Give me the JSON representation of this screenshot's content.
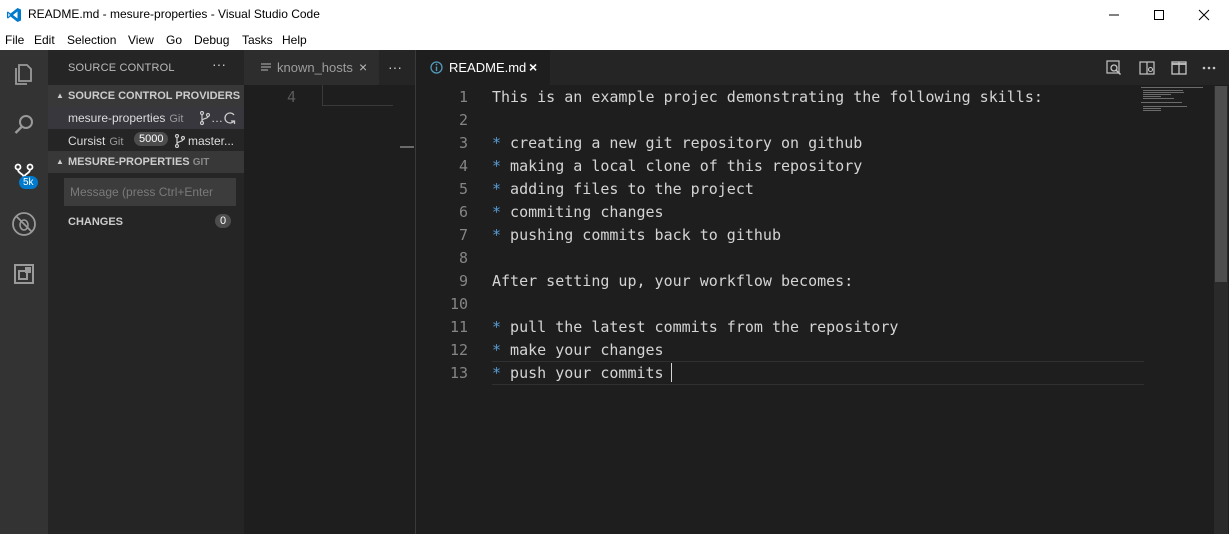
{
  "window": {
    "title": "README.md - mesure-properties - Visual Studio Code"
  },
  "menu": [
    "File",
    "Edit",
    "Selection",
    "View",
    "Go",
    "Debug",
    "Tasks",
    "Help"
  ],
  "activity_bar": {
    "items": [
      "explorer-icon",
      "search-icon",
      "source-control-icon",
      "debug-icon",
      "extensions-icon"
    ],
    "scm_badge": "5k"
  },
  "sidebar": {
    "title": "SOURCE CONTROL",
    "more": "···",
    "providers_header": "SOURCE CONTROL PROVIDERS",
    "providers": [
      {
        "name": "mesure-properties",
        "type": "Git",
        "extra": "…"
      },
      {
        "name": "Cursist",
        "type": "Git",
        "count": "5000",
        "branch": "master..."
      }
    ],
    "repo_header": "MESURE-PROPERTIES",
    "repo_header_type": "GIT",
    "message_placeholder": "Message (press Ctrl+Enter",
    "changes_label": "CHANGES",
    "changes_count": "0"
  },
  "editor_group1": {
    "tab_label": "known_hosts",
    "close": "×",
    "more": "···",
    "line_number": "4"
  },
  "editor_group2": {
    "tab_label": "README.md",
    "close": "×",
    "lines": [
      {
        "n": "1",
        "bullet": "",
        "text": "This is an example projec demonstrating the following skills:"
      },
      {
        "n": "2",
        "bullet": "",
        "text": ""
      },
      {
        "n": "3",
        "bullet": "*",
        "text": " creating a new git repository on github"
      },
      {
        "n": "4",
        "bullet": "*",
        "text": " making a local clone of this repository"
      },
      {
        "n": "5",
        "bullet": "*",
        "text": " adding files to the project"
      },
      {
        "n": "6",
        "bullet": "*",
        "text": " commiting changes"
      },
      {
        "n": "7",
        "bullet": "*",
        "text": " pushing commits back to github"
      },
      {
        "n": "8",
        "bullet": "",
        "text": ""
      },
      {
        "n": "9",
        "bullet": "",
        "text": "After setting up, your workflow becomes:"
      },
      {
        "n": "10",
        "bullet": "",
        "text": ""
      },
      {
        "n": "11",
        "bullet": "*",
        "text": " pull the latest commits from the repository"
      },
      {
        "n": "12",
        "bullet": "*",
        "text": " make your changes"
      },
      {
        "n": "13",
        "bullet": "*",
        "text": " push your commits"
      }
    ]
  },
  "colors": {
    "accent": "#007acc",
    "bullet": "#569cd6",
    "editor_bg": "#1e1e1e"
  }
}
